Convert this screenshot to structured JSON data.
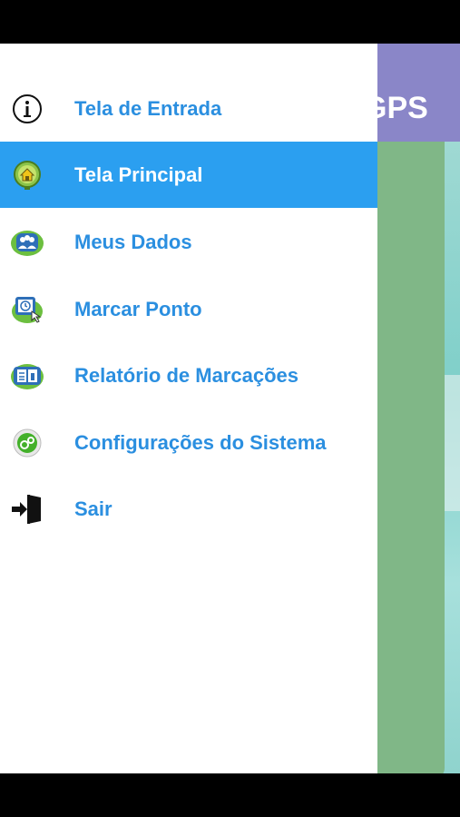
{
  "background": {
    "header_text": "GPS"
  },
  "menu": {
    "items": [
      {
        "label": "Tela de Entrada",
        "icon": "info-icon",
        "active": false
      },
      {
        "label": "Tela Principal",
        "icon": "home-icon",
        "active": true
      },
      {
        "label": "Meus Dados",
        "icon": "users-icon",
        "active": false
      },
      {
        "label": "Marcar Ponto",
        "icon": "clock-in-icon",
        "active": false
      },
      {
        "label": "Relatório de Marcações",
        "icon": "report-icon",
        "active": false
      },
      {
        "label": "Configurações do Sistema",
        "icon": "settings-icon",
        "active": false
      },
      {
        "label": "Sair",
        "icon": "exit-icon",
        "active": false
      }
    ]
  },
  "colors": {
    "accent": "#2b9ff0",
    "label": "#2b8fe0",
    "header": "#8a86c8",
    "card": "#80b787"
  }
}
